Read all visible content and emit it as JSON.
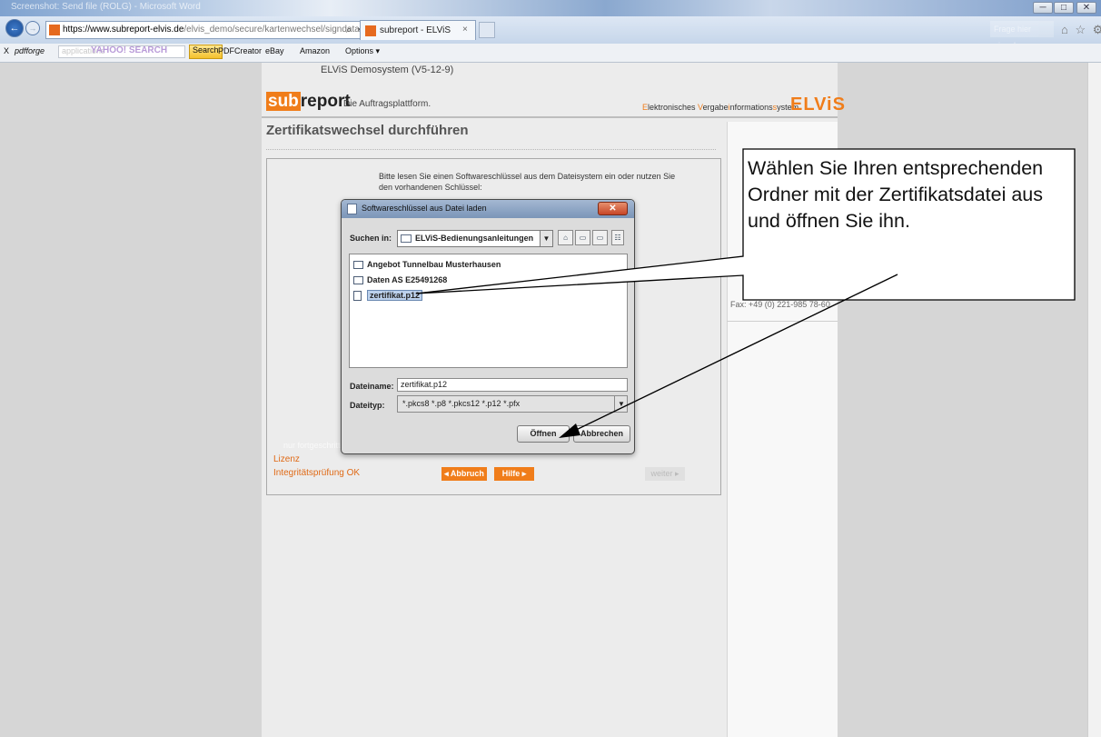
{
  "window": {
    "title": "Screenshot: Send file (ROLG) - Microsoft Word",
    "minimize": "─",
    "maximize": "□",
    "close": "✕"
  },
  "browser": {
    "address": {
      "domain": "https://www.subreport-elvis.de",
      "path": "/elvis_demo/secure/kartenwechsel/signdata.pl",
      "tools": "⌕ ▾ 🔒 ⊟ ↻ ✕"
    },
    "tab": {
      "label": "subreport - ELViS",
      "close": "×"
    },
    "search_placeholder": "Frage hier eingeben",
    "right_icons": "⌂ ☆ ⚙"
  },
  "toolbar": {
    "close": "X",
    "pdfforge": "pdfforge",
    "search_hint": "applications",
    "yahoo": "YAHOO! SEARCH",
    "search_button": "Search",
    "pdfcreator": "PDFCreator",
    "ebay": "eBay",
    "amazon": "Amazon",
    "options": "Options ▾"
  },
  "page": {
    "demosystem": "ELViS Demosystem (V5-12-9)",
    "logo": {
      "sub": "sub",
      "report": "report"
    },
    "tagline": "Die Auftragsplattform.",
    "elvis_long": {
      "e": "E",
      "w1": "lektronisches ",
      "v": "V",
      "w2": "ergabe",
      "i": "i",
      "w3": "nformations",
      "s": "s",
      "w4": "ystem"
    },
    "elvis_logo": "ELViS",
    "title": "Zertifikatswechsel durchführen",
    "intro": "Bitte lesen Sie einen Softwareschlüssel aus dem Dateisystem ein oder nutzen Sie den vorhandenen Schlüssel:",
    "faded": "nur fortgeschritten",
    "lizenz": "Lizenz",
    "integrity": "Integritätsprüfung OK",
    "abbruch": "◂ Abbruch",
    "hilfe": "Hilfe ▸",
    "weiter": "weiter ▸",
    "fax": "Fax: +49 (0) 221-985 78-60"
  },
  "dialog": {
    "title": "Softwareschlüssel aus Datei laden",
    "close": "✕",
    "look_in_label": "Suchen in:",
    "look_in_value": "ELViS-Bedienungsanleitungen",
    "arrow": "▼",
    "toolbar_icons": [
      "⌂",
      "▭",
      "▭",
      "☷",
      "☰"
    ],
    "files": [
      "Angebot Tunnelbau Musterhausen",
      "Daten AS E25491268",
      "zertifikat.p12"
    ],
    "filename_label": "Dateiname:",
    "filename_value": "zertifikat.p12",
    "filetype_label": "Dateityp:",
    "filetype_value": "*.pkcs8 *.p8 *.pkcs12 *.p12 *.pfx",
    "open_button": "Öffnen",
    "cancel_button": "Abbrechen"
  },
  "callout": {
    "text": "Wählen Sie Ihren entsprechenden Ordner mit der Zertifikatsdatei aus und öffnen Sie ihn."
  },
  "colors": {
    "brand_orange": "#f07d1a",
    "selection": "#bcd1ec"
  }
}
